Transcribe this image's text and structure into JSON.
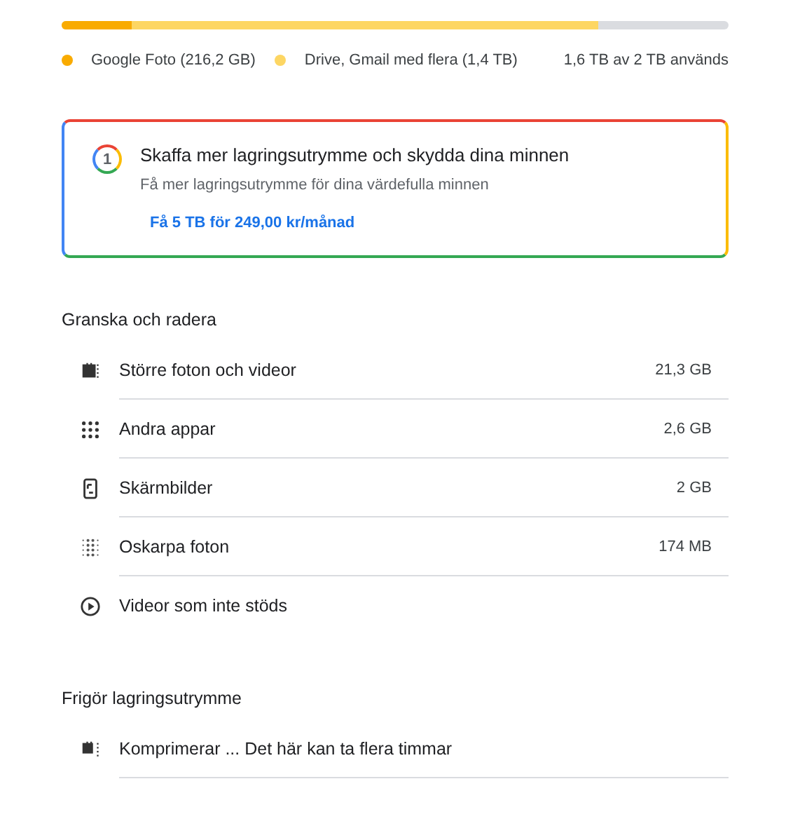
{
  "storage": {
    "segments": [
      {
        "label": "Google Foto (216,2 GB)",
        "color": "#f9ab00",
        "level": 0.105
      },
      {
        "label": "Drive, Gmail med flera (1,4 TB)",
        "color": "#fdd663",
        "level": 0.805
      }
    ],
    "summary": "1,6 TB av 2 TB används"
  },
  "promo": {
    "badge": "1",
    "title": "Skaffa mer lagringsutrymme och skydda dina minnen",
    "subtitle": "Få mer lagringsutrymme för dina värdefulla minnen",
    "link": "Få 5 TB för 249,00 kr/månad"
  },
  "review": {
    "heading": "Granska och radera",
    "items": [
      {
        "kind": "large",
        "label": "Större foton och videor",
        "size": "21,3 GB"
      },
      {
        "kind": "apps",
        "label": "Andra appar",
        "size": "2,6 GB"
      },
      {
        "kind": "screenshot",
        "label": "Skärmbilder",
        "size": "2 GB"
      },
      {
        "kind": "blurry",
        "label": "Oskarpa foton",
        "size": "174 MB"
      },
      {
        "kind": "video",
        "label": "Videor som inte stöds"
      }
    ]
  },
  "free_up": {
    "heading": "Frigör lagringsutrymme",
    "items": [
      {
        "kind": "compress",
        "label": "Komprimerar ... Det här kan ta flera timmar"
      }
    ]
  }
}
